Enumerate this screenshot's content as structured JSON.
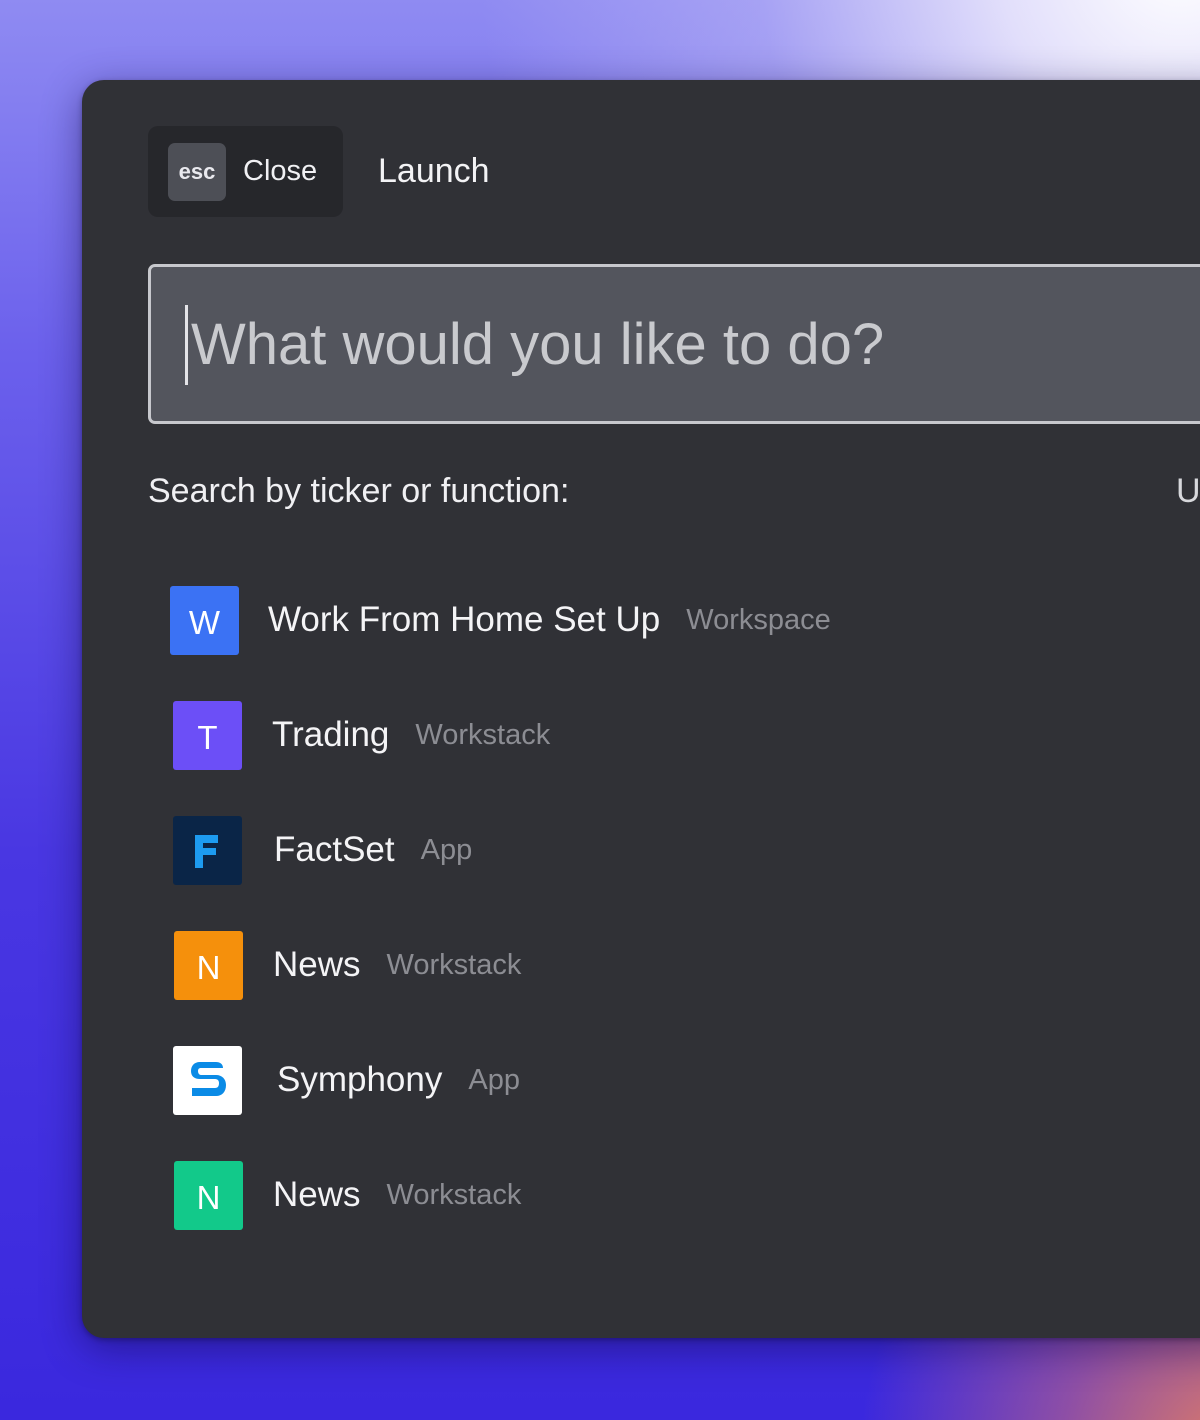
{
  "header": {
    "esc_key": "esc",
    "close_label": "Close",
    "title": "Launch"
  },
  "search": {
    "placeholder": "What would you like to do?",
    "value": ""
  },
  "hint": "Search by ticker or function:",
  "right_hint_partial": "U",
  "colors": {
    "panel_bg": "#303136",
    "search_bg": "#53555d",
    "workspace_blue": "#3b72f4",
    "workstack_purple": "#6c4ff7",
    "factset_navy": "#0a2547",
    "factset_accent": "#1d9bf0",
    "news_orange": "#f5900c",
    "symphony_white": "#ffffff",
    "symphony_blue": "#0b8be6",
    "news_green": "#12c98a"
  },
  "results": [
    {
      "letter": "W",
      "name": "Work From Home Set Up",
      "type": "Workspace",
      "color": "#3b72f4"
    },
    {
      "letter": "T",
      "name": "Trading",
      "type": "Workstack",
      "color": "#6c4ff7"
    },
    {
      "letter": "",
      "icon": "factset-logo-icon",
      "name": "FactSet",
      "type": "App",
      "color": "#0a2547"
    },
    {
      "letter": "N",
      "name": "News",
      "type": "Workstack",
      "color": "#f5900c"
    },
    {
      "letter": "",
      "icon": "symphony-logo-icon",
      "name": "Symphony",
      "type": "App",
      "color": "#ffffff"
    },
    {
      "letter": "N",
      "name": "News",
      "type": "Workstack",
      "color": "#12c98a"
    }
  ]
}
